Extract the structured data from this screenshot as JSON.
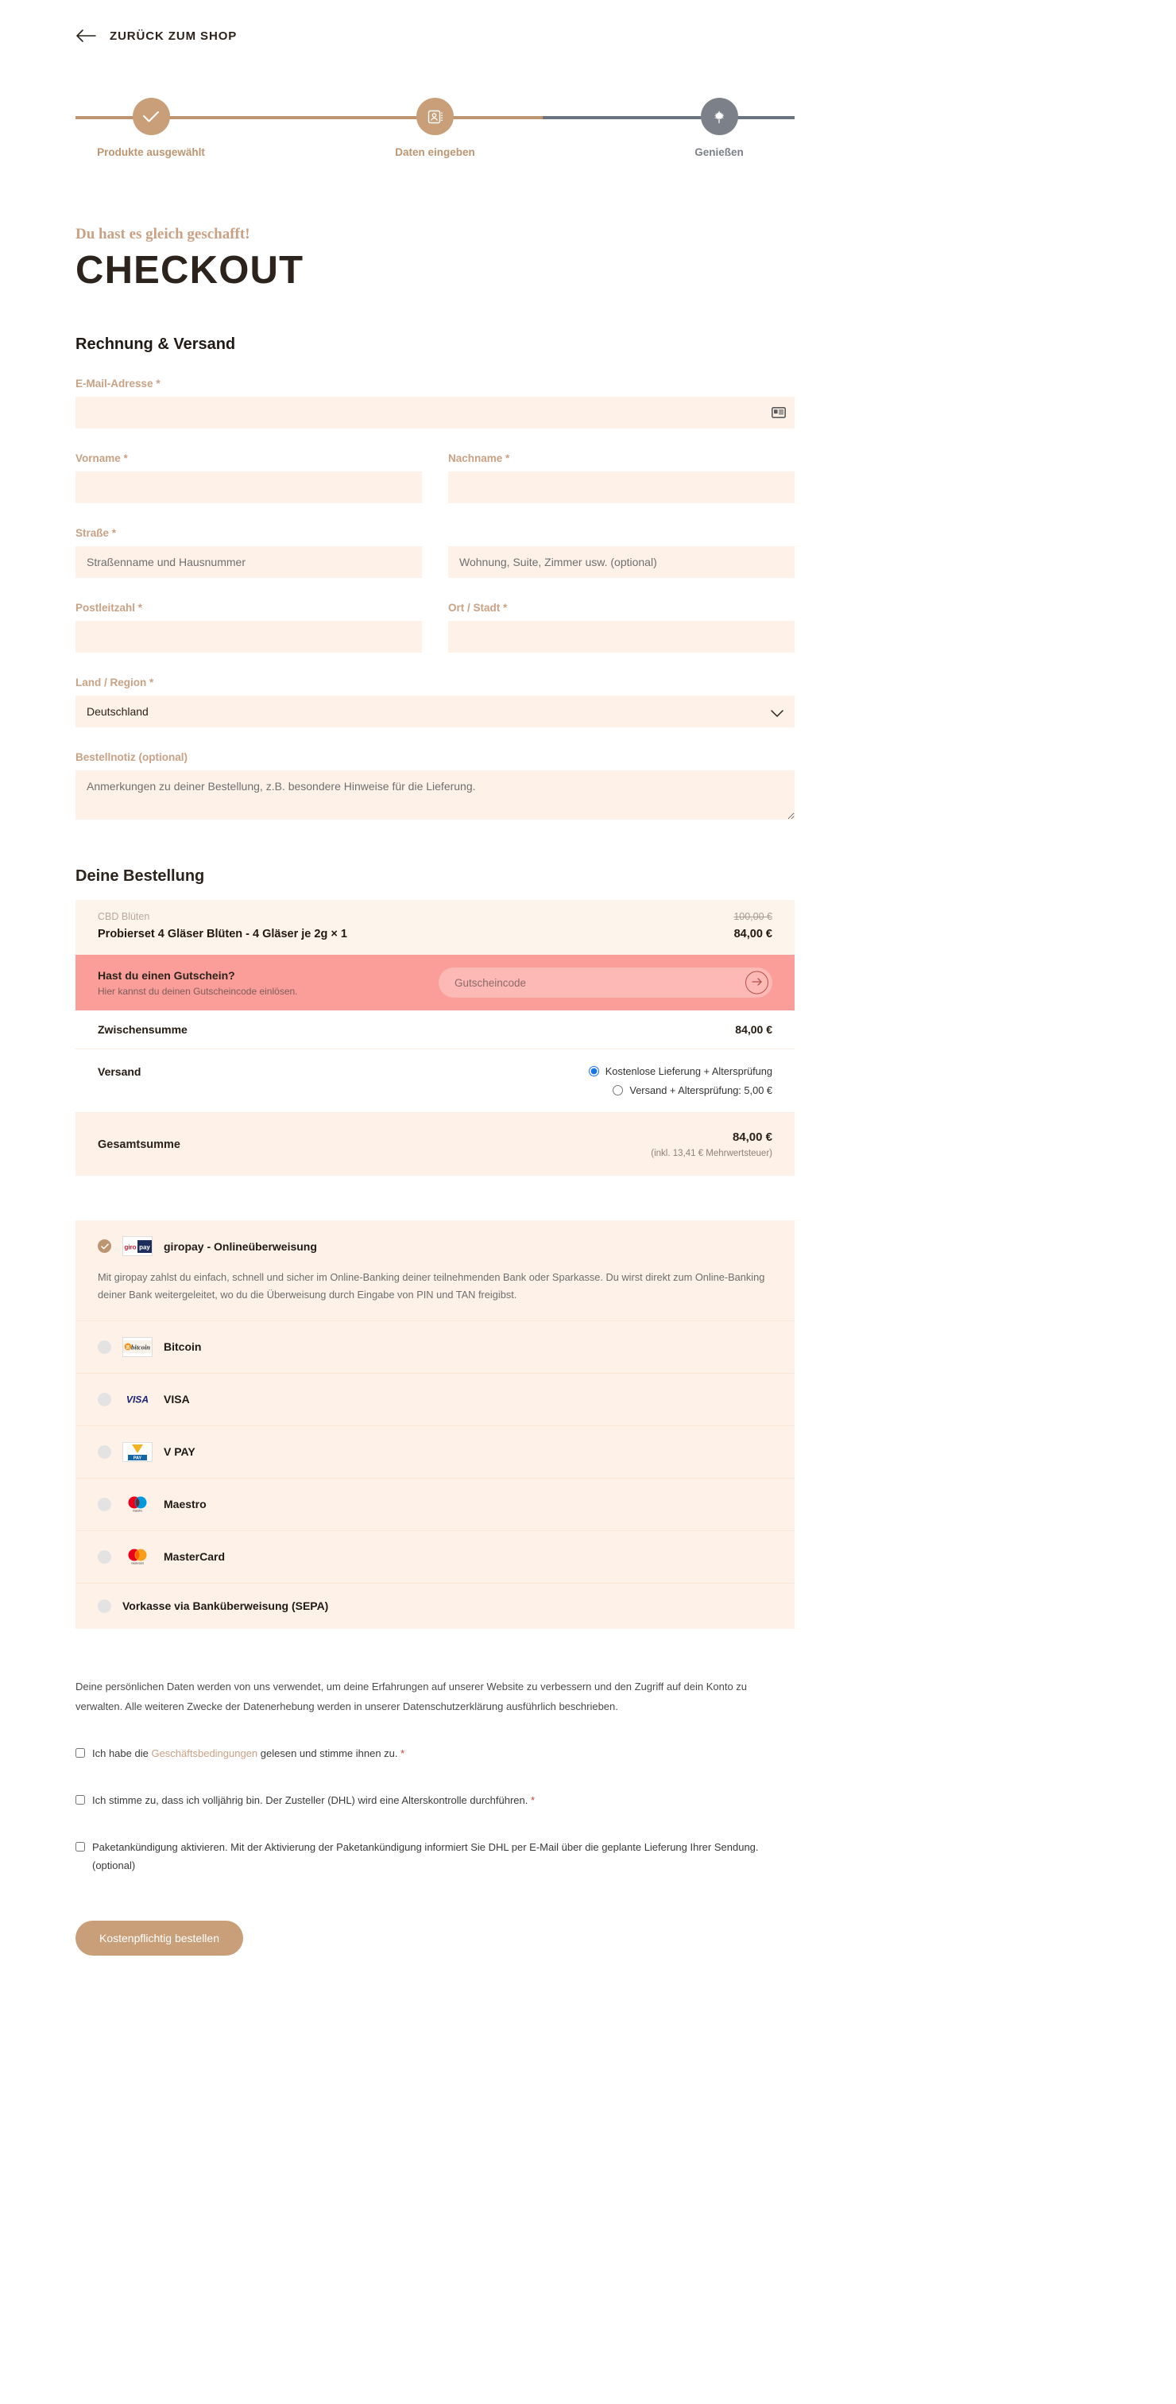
{
  "topbar": {
    "back_label": "ZURÜCK ZUM SHOP",
    "back_icon": "arrow-left-icon"
  },
  "stepper": {
    "steps": [
      {
        "label": "Produkte ausgewählt",
        "icon": "check-icon",
        "state": "done"
      },
      {
        "label": "Daten eingeben",
        "icon": "contact-card-icon",
        "state": "active"
      },
      {
        "label": "Genießen",
        "icon": "leaf-icon",
        "state": "inactive"
      }
    ],
    "active_color": "#c89f78",
    "inactive_color": "#7c8189"
  },
  "header": {
    "eyebrow": "Du hast es gleich geschafft!",
    "title": "CHECKOUT"
  },
  "billing": {
    "section_title": "Rechnung & Versand",
    "email": {
      "label": "E-Mail-Adresse",
      "required": "*",
      "value": "",
      "placeholder": "",
      "icon": "contact-card-icon"
    },
    "first_name": {
      "label": "Vorname",
      "required": "*",
      "value": "",
      "placeholder": ""
    },
    "last_name": {
      "label": "Nachname",
      "required": "*",
      "value": "",
      "placeholder": ""
    },
    "street": {
      "label": "Straße",
      "required": "*",
      "value": "",
      "placeholder": "Straßenname und Hausnummer"
    },
    "street2": {
      "label": "",
      "value": "",
      "placeholder": "Wohnung, Suite, Zimmer usw. (optional)"
    },
    "postcode": {
      "label": "Postleitzahl",
      "required": "*",
      "value": "",
      "placeholder": ""
    },
    "city": {
      "label": "Ort / Stadt",
      "required": "*",
      "value": "",
      "placeholder": ""
    },
    "country": {
      "label": "Land / Region",
      "required": "*",
      "value": "Deutschland",
      "icon": "chevron-down-icon"
    },
    "note": {
      "label": "Bestellnotiz (optional)",
      "value": "",
      "placeholder": "Anmerkungen zu deiner Bestellung, z.B. besondere Hinweise für die Lieferung."
    }
  },
  "order": {
    "section_title": "Deine Bestellung",
    "item": {
      "category": "CBD Blüten",
      "name": "Probierset 4 Gläser Blüten - 4 Gläser je 2g",
      "qty": "× 1",
      "price_old": "100,00 €",
      "price_new": "84,00 €"
    },
    "coupon": {
      "title": "Hast du einen Gutschein?",
      "subtitle": "Hier kannst du deinen Gutscheincode einlösen.",
      "placeholder": "Gutscheincode",
      "value": "",
      "submit_icon": "arrow-right-icon",
      "background": "#fb9e9a"
    },
    "subtotal": {
      "label": "Zwischensumme",
      "value": "84,00 €"
    },
    "shipping": {
      "label": "Versand",
      "options": [
        {
          "label": "Kostenlose Lieferung + Altersprüfung",
          "selected": true
        },
        {
          "label": "Versand + Altersprüfung: 5,00 €",
          "selected": false
        }
      ]
    },
    "total": {
      "label": "Gesamtsumme",
      "value": "84,00 €",
      "tax_note": "(inkl. 13,41 € Mehrwertsteuer)"
    }
  },
  "payment": {
    "methods": [
      {
        "label": "giropay - Onlineüberweisung",
        "logo": "giropay-logo",
        "selected": true,
        "description": "Mit giropay zahlst du einfach, schnell und sicher im Online-Banking deiner teilnehmenden Bank oder Sparkasse. Du wirst direkt zum Online-Banking deiner Bank weitergeleitet, wo du die Überweisung durch Eingabe von PIN und TAN freigibst."
      },
      {
        "label": "Bitcoin",
        "logo": "bitcoin-logo",
        "selected": false,
        "description": ""
      },
      {
        "label": "VISA",
        "logo": "visa-logo",
        "selected": false,
        "description": ""
      },
      {
        "label": "V PAY",
        "logo": "vpay-logo",
        "selected": false,
        "description": ""
      },
      {
        "label": "Maestro",
        "logo": "maestro-logo",
        "selected": false,
        "description": ""
      },
      {
        "label": "MasterCard",
        "logo": "mastercard-logo",
        "selected": false,
        "description": ""
      },
      {
        "label": "Vorkasse via Banküberweisung (SEPA)",
        "logo": "",
        "selected": false,
        "description": ""
      }
    ]
  },
  "legal": {
    "privacy_text": "Deine persönlichen Daten werden von uns verwendet, um deine Erfahrungen auf unserer Website zu verbessern und den Zugriff auf dein Konto zu verwalten. Alle weiteren Zwecke der Datenerhebung werden in unserer Datenschutzerklärung ausführlich beschrieben.",
    "terms": {
      "prefix": "Ich habe die ",
      "link": "Geschäftsbedingungen",
      "suffix": " gelesen und stimme ihnen zu. ",
      "required": "*",
      "checked": false
    },
    "age": {
      "text": "Ich stimme zu, dass ich volljährig bin. Der Zusteller (DHL) wird eine Alterskontrolle durchführen. ",
      "required": "*",
      "checked": false
    },
    "parcel": {
      "text": "Paketankündigung aktivieren. Mit der Aktivierung der Paketankündigung informiert Sie DHL per E-Mail über die geplante Lieferung Ihrer Sendung. (optional)",
      "checked": false
    }
  },
  "submit": {
    "label": "Kostenpflichtig bestellen",
    "color": "#c89f78"
  }
}
